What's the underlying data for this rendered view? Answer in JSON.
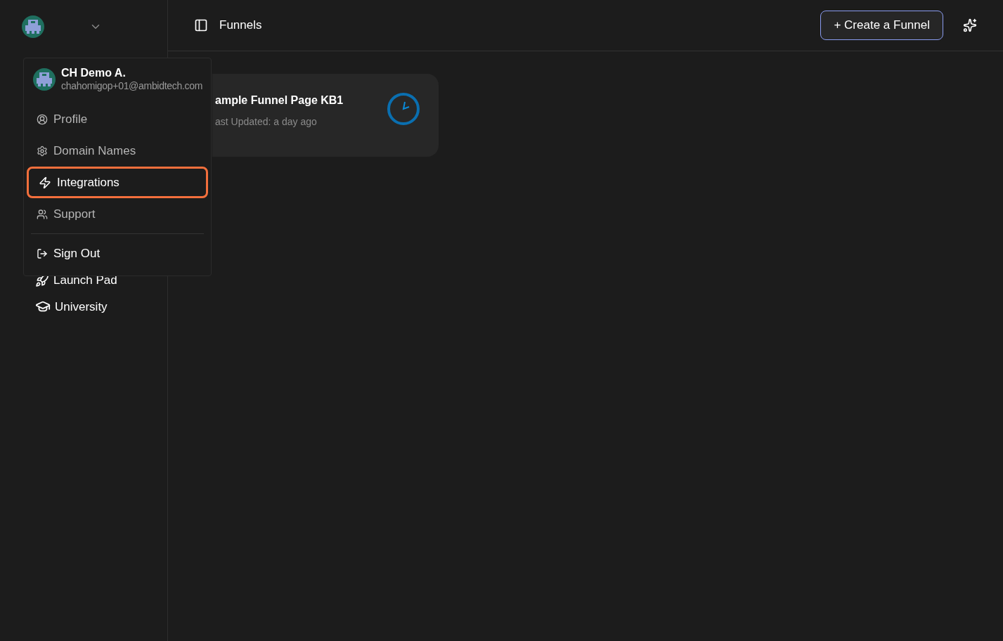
{
  "sidebar": {
    "nav_items": [
      {
        "label": "Launch Pad",
        "kind": "launch"
      },
      {
        "label": "University",
        "kind": "university"
      }
    ]
  },
  "header": {
    "title": "Funnels",
    "create_button": "+ Create a Funnel"
  },
  "funnel_cards": [
    {
      "title": "ample Funnel Page KB1",
      "subtitle": "ast Updated: a day ago"
    }
  ],
  "account_menu": {
    "name": "CH Demo A.",
    "email": "chahomigop+01@ambidtech.com",
    "items": [
      {
        "label": "Profile",
        "kind": "profile",
        "selected": false
      },
      {
        "label": "Domain Names",
        "kind": "domain",
        "selected": false
      },
      {
        "label": "Integrations",
        "kind": "integrations",
        "selected": true
      },
      {
        "label": "Support",
        "kind": "support",
        "selected": false
      },
      {
        "label": "Sign Out",
        "kind": "signout",
        "selected": false
      }
    ]
  }
}
